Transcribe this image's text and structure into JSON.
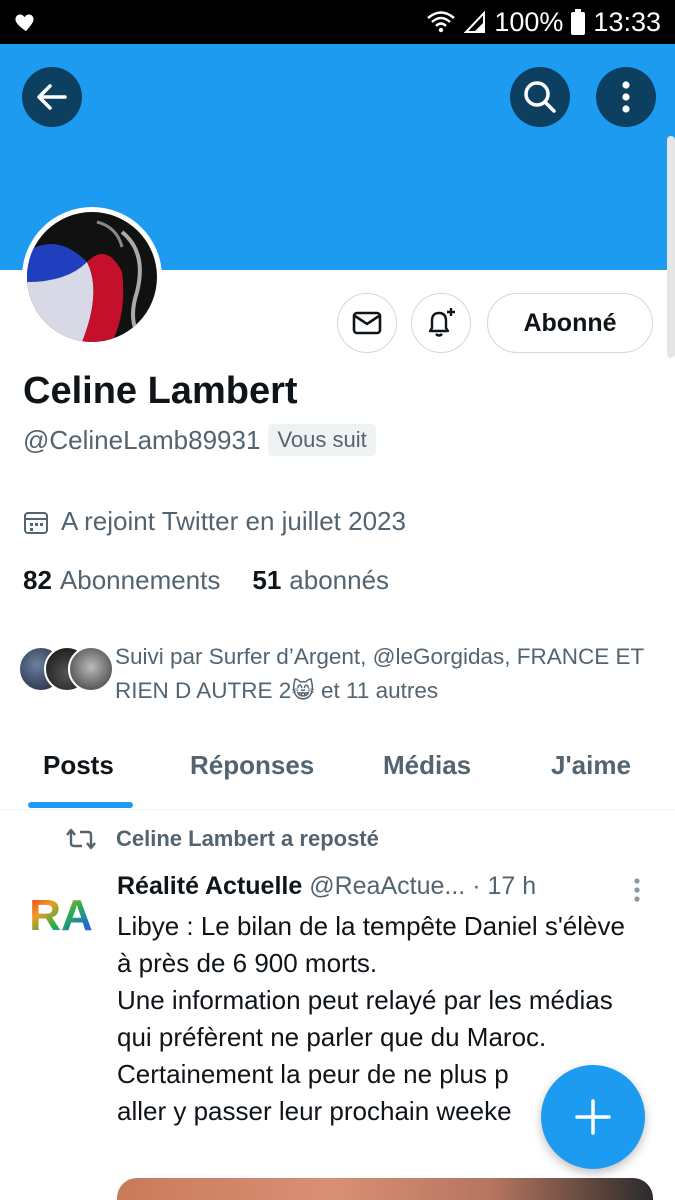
{
  "status_bar": {
    "battery": "100%",
    "time": "13:33"
  },
  "header": {
    "back_icon": "arrow-left-icon",
    "search_icon": "search-icon",
    "more_icon": "more-vertical-icon",
    "banner_color": "#1d9bf0",
    "button_color": "#0d3f60"
  },
  "profile": {
    "name": "Celine Lambert",
    "handle": "@CelineLamb89931",
    "follows_you": "Vous suit",
    "joined": "A rejoint Twitter en juillet 2023",
    "following_count": "82",
    "following_label": "Abonnements",
    "followers_count": "51",
    "followers_label": "abonnés",
    "followed_by": "Suivi par Surfer d’Argent, @leGorgidas, FRANCE ET RIEN D AUTRE 2😸 et 11 autres",
    "follow_button": "Abonné"
  },
  "tabs": [
    {
      "label": "Posts",
      "active": true
    },
    {
      "label": "Réponses",
      "active": false
    },
    {
      "label": "Médias",
      "active": false
    },
    {
      "label": "J'aime",
      "active": false
    }
  ],
  "post": {
    "repost_label": "Celine Lambert a reposté",
    "author": "Réalité Actuelle",
    "handle": "@ReaActue...",
    "time": "· 17 h",
    "avatar_text": "RA",
    "text": "Libye : Le bilan de la tempête Daniel s'élève à près de 6 900 morts.\nUne information peut relayé par les médias qui préfèrent ne parler que du Maroc.\nCertainement la peur de ne plus p\naller y passer leur prochain weeke"
  },
  "accent_color": "#1d9bf0"
}
